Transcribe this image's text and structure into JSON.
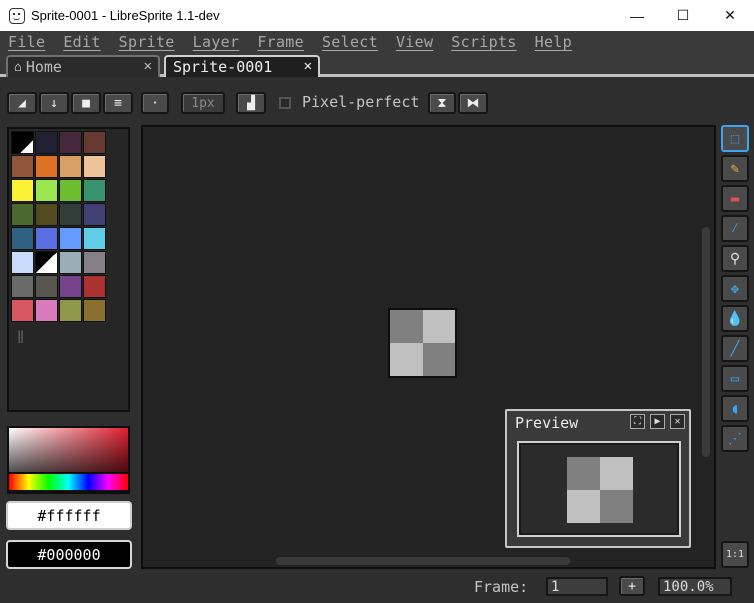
{
  "window": {
    "title": "Sprite-0001 - LibreSprite 1.1-dev",
    "minimize": "—",
    "maximize": "☐",
    "close": "✕"
  },
  "menu": [
    "File",
    "Edit",
    "Sprite",
    "Layer",
    "Frame",
    "Select",
    "View",
    "Scripts",
    "Help"
  ],
  "tabs": [
    {
      "label": "Home",
      "icon": "home-icon",
      "close": "✕"
    },
    {
      "label": "Sprite-0001",
      "close": "✕"
    }
  ],
  "toolbar": {
    "brush_size": "1px",
    "pixel_perfect_label": "Pixel-perfect"
  },
  "palette": [
    "#000000",
    "#222034",
    "#45283c",
    "#663931",
    "#8f563b",
    "#df7126",
    "#d9a066",
    "#eec39a",
    "#fbf236",
    "#99e550",
    "#6abe30",
    "#37946e",
    "#4b692f",
    "#524b24",
    "#323c39",
    "#3f3f74",
    "#306082",
    "#5b6ee1",
    "#639bff",
    "#5fcde4",
    "#cbdbfc",
    "#ffffff",
    "#9badb7",
    "#847e87",
    "#696a6a",
    "#595652",
    "#76428a",
    "#ac3232",
    "#d95763",
    "#d77bba",
    "#8f974a",
    "#8a6f30"
  ],
  "foreground_color": "#ffffff",
  "background_color": "#000000",
  "sprite_pixels": [
    "#808080",
    "#c0c0c0",
    "#c0c0c0",
    "#808080"
  ],
  "preview": {
    "title": "Preview",
    "btn_fullscreen": "⛶",
    "btn_play": "▶",
    "btn_close": "✕"
  },
  "tools": [
    {
      "name": "rectangular-marquee-icon",
      "glyph": "⬚"
    },
    {
      "name": "pencil-icon",
      "glyph": "✎"
    },
    {
      "name": "eraser-icon",
      "glyph": "▬"
    },
    {
      "name": "eyedropper-icon",
      "glyph": "⁄"
    },
    {
      "name": "zoom-icon",
      "glyph": "⚲"
    },
    {
      "name": "move-icon",
      "glyph": "✥"
    },
    {
      "name": "paint-bucket-icon",
      "glyph": "💧"
    },
    {
      "name": "line-icon",
      "glyph": "╱"
    },
    {
      "name": "rectangle-icon",
      "glyph": "▭"
    },
    {
      "name": "freehand-lasso-icon",
      "glyph": "◖"
    },
    {
      "name": "spray-icon",
      "glyph": "⋰"
    }
  ],
  "zoom_reset": "1:1",
  "status": {
    "frame_label": "Frame:",
    "frame_value": "1",
    "add_frame": "+",
    "zoom": "100.0%"
  },
  "colors": {
    "accent": "#39a5f4",
    "panel": "#2e2e2e",
    "canvas": "#232323"
  }
}
